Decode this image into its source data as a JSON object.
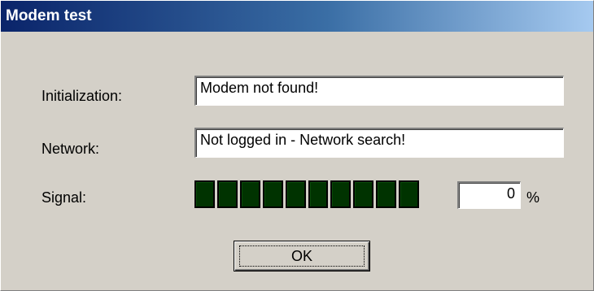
{
  "window": {
    "title": "Modem test"
  },
  "form": {
    "initialization_label": "Initialization:",
    "initialization_value": "Modem not found!",
    "network_label": "Network:",
    "network_value": "Not logged in - Network search!",
    "signal_label": "Signal:",
    "signal_percent_value": "0",
    "percent_sign": "%"
  },
  "signal": {
    "segment_count": 10,
    "level_percent": 0,
    "segment_color": "#003300"
  },
  "buttons": {
    "ok_label": "OK"
  },
  "colors": {
    "dialog_bg": "#d4d0c8",
    "titlebar_start": "#0a246a",
    "titlebar_end": "#a6caf0"
  }
}
